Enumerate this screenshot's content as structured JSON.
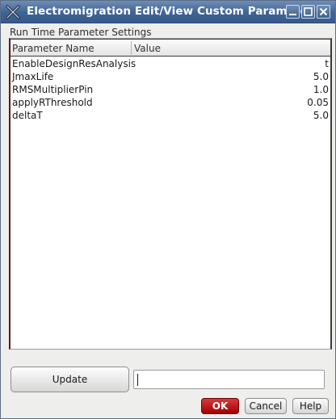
{
  "window": {
    "title": "Electromigration Edit/View Custom Paramete"
  },
  "section_label": "Run Time Parameter Settings",
  "table": {
    "headers": {
      "name": "Parameter Name",
      "value": "Value"
    },
    "rows": [
      {
        "name": "EnableDesignResAnalysis",
        "value": "t"
      },
      {
        "name": "JmaxLife",
        "value": "5.0"
      },
      {
        "name": "RMSMultiplierPin",
        "value": "1.0"
      },
      {
        "name": "applyRThreshold",
        "value": "0.05"
      },
      {
        "name": "deltaT",
        "value": "5.0"
      }
    ]
  },
  "update": {
    "label": "Update"
  },
  "input": {
    "value": ""
  },
  "buttons": {
    "ok": "OK",
    "cancel": "Cancel",
    "help": "Help"
  },
  "colors": {
    "titlebar": "#3f6394",
    "ok_button": "#b80000"
  }
}
